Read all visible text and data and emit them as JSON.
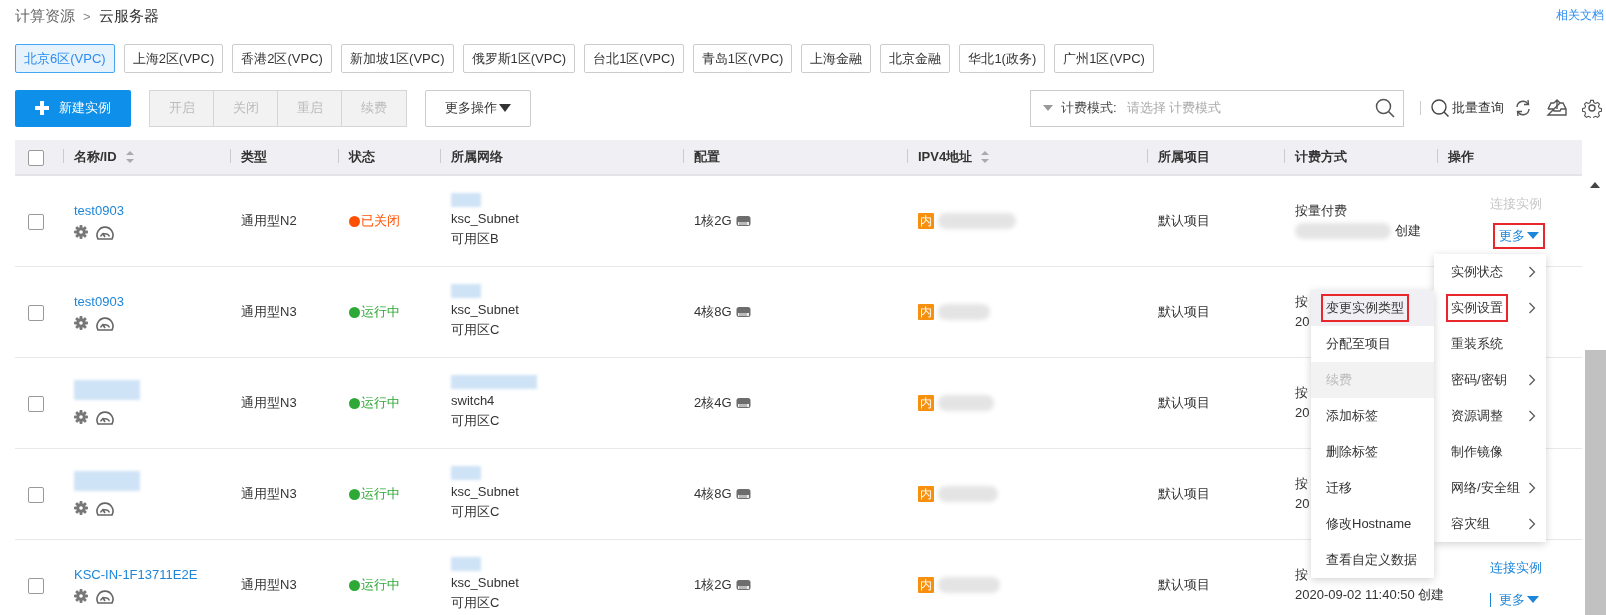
{
  "breadcrumb": {
    "parent": "计算资源",
    "separator": ">",
    "current": "云服务器"
  },
  "help_link": "相关文档",
  "regions": [
    {
      "label": "北京6区(VPC)",
      "selected": true
    },
    {
      "label": "上海2区(VPC)",
      "selected": false
    },
    {
      "label": "香港2区(VPC)",
      "selected": false
    },
    {
      "label": "新加坡1区(VPC)",
      "selected": false
    },
    {
      "label": "俄罗斯1区(VPC)",
      "selected": false
    },
    {
      "label": "台北1区(VPC)",
      "selected": false
    },
    {
      "label": "青岛1区(VPC)",
      "selected": false
    },
    {
      "label": "上海金融",
      "selected": false
    },
    {
      "label": "北京金融",
      "selected": false
    },
    {
      "label": "华北1(政务)",
      "selected": false
    },
    {
      "label": "广州1区(VPC)",
      "selected": false
    }
  ],
  "toolbar": {
    "create_button": "新建实例",
    "batch_buttons": [
      {
        "label": "开启",
        "disabled": true
      },
      {
        "label": "关闭",
        "disabled": true
      },
      {
        "label": "重启",
        "disabled": true
      },
      {
        "label": "续费",
        "disabled": true
      }
    ],
    "more_button": "更多操作"
  },
  "filter": {
    "label": "计费模式:",
    "placeholder": "请选择 计费模式"
  },
  "batch_query": "批量查询",
  "table": {
    "select_all": false,
    "columns": [
      {
        "label": "名称/ID",
        "sortable": true
      },
      {
        "label": "类型",
        "sortable": false
      },
      {
        "label": "状态",
        "sortable": false
      },
      {
        "label": "所属网络",
        "sortable": false
      },
      {
        "label": "配置",
        "sortable": false
      },
      {
        "label": "IPV4地址",
        "sortable": true
      },
      {
        "label": "所属项目",
        "sortable": false
      },
      {
        "label": "计费方式",
        "sortable": false
      },
      {
        "label": "操作",
        "sortable": false
      }
    ],
    "rows": [
      {
        "checked": false,
        "name": "test0903",
        "type": "通用型N2",
        "status": {
          "label": "已关闭",
          "color": "#ff5000"
        },
        "network": [
          "ksc_Subnet",
          "可用区B"
        ],
        "config": "1核2G",
        "ip_tag": "内",
        "project": "默认项目",
        "billing": {
          "mode": "按量付费",
          "created": "创建",
          "date_redacted": true
        },
        "actions": {
          "connect": {
            "label": "连接实例",
            "disabled": true
          },
          "more": {
            "label": "更多",
            "highlighted": true
          }
        }
      },
      {
        "checked": false,
        "name": "test0903",
        "type": "通用型N3",
        "status": {
          "label": "运行中",
          "color": "#2ea836"
        },
        "network": [
          "ksc_Subnet",
          "可用区C"
        ],
        "config": "4核8G",
        "ip_tag": "内",
        "project": "默认项目",
        "billing": {
          "mode": "按",
          "created": "20",
          "date_redacted": false
        }
      },
      {
        "checked": false,
        "name_redacted": true,
        "type": "通用型N3",
        "status": {
          "label": "运行中",
          "color": "#2ea836"
        },
        "network": [
          "switch4",
          "可用区C"
        ],
        "config": "2核4G",
        "ip_tag": "内",
        "project": "默认项目",
        "billing": {
          "mode": "按",
          "created": "20",
          "date_redacted": false
        }
      },
      {
        "checked": false,
        "name_redacted": true,
        "type": "通用型N3",
        "status": {
          "label": "运行中",
          "color": "#2ea836"
        },
        "network": [
          "ksc_Subnet",
          "可用区C"
        ],
        "config": "4核8G",
        "ip_tag": "内",
        "project": "默认项目",
        "billing": {
          "mode": "按",
          "created": "20",
          "date_redacted": false
        }
      },
      {
        "checked": false,
        "name": "KSC-IN-1F13711E2E",
        "type": "通用型N3",
        "status": {
          "label": "运行中",
          "color": "#2ea836"
        },
        "network": [
          "ksc_Subnet",
          "可用区C"
        ],
        "config": "1核2G",
        "ip_tag": "内",
        "project": "默认项目",
        "billing": {
          "mode": "按",
          "created": "2020-09-02 11:40:50 创建",
          "date_redacted": false
        },
        "actions": {
          "connect": {
            "label": "连接实例",
            "disabled": false
          },
          "more": {
            "label": "更多",
            "highlighted": false
          }
        }
      }
    ]
  },
  "menu": {
    "items": [
      {
        "label": "实例状态",
        "has_submenu": true,
        "highlighted": false
      },
      {
        "label": "实例设置",
        "has_submenu": true,
        "highlighted": true
      },
      {
        "label": "重装系统",
        "has_submenu": false,
        "highlighted": false
      },
      {
        "label": "密码/密钥",
        "has_submenu": true,
        "highlighted": false
      },
      {
        "label": "资源调整",
        "has_submenu": true,
        "highlighted": false
      },
      {
        "label": "制作镜像",
        "has_submenu": false,
        "highlighted": false
      },
      {
        "label": "网络/安全组",
        "has_submenu": true,
        "highlighted": false
      },
      {
        "label": "容灾组",
        "has_submenu": true,
        "highlighted": false
      }
    ]
  },
  "submenu": {
    "items": [
      {
        "label": "变更实例类型",
        "hovered": true,
        "highlighted": true,
        "disabled": false
      },
      {
        "label": "分配至项目",
        "hovered": false,
        "highlighted": false,
        "disabled": false
      },
      {
        "label": "续费",
        "hovered": false,
        "highlighted": false,
        "disabled": true
      },
      {
        "label": "添加标签",
        "hovered": false,
        "highlighted": false,
        "disabled": false
      },
      {
        "label": "删除标签",
        "hovered": false,
        "highlighted": false,
        "disabled": false
      },
      {
        "label": "迁移",
        "hovered": false,
        "highlighted": false,
        "disabled": false
      },
      {
        "label": "修改Hostname",
        "hovered": false,
        "highlighted": false,
        "disabled": false
      },
      {
        "label": "查看自定义数据",
        "hovered": false,
        "highlighted": false,
        "disabled": false
      }
    ]
  }
}
